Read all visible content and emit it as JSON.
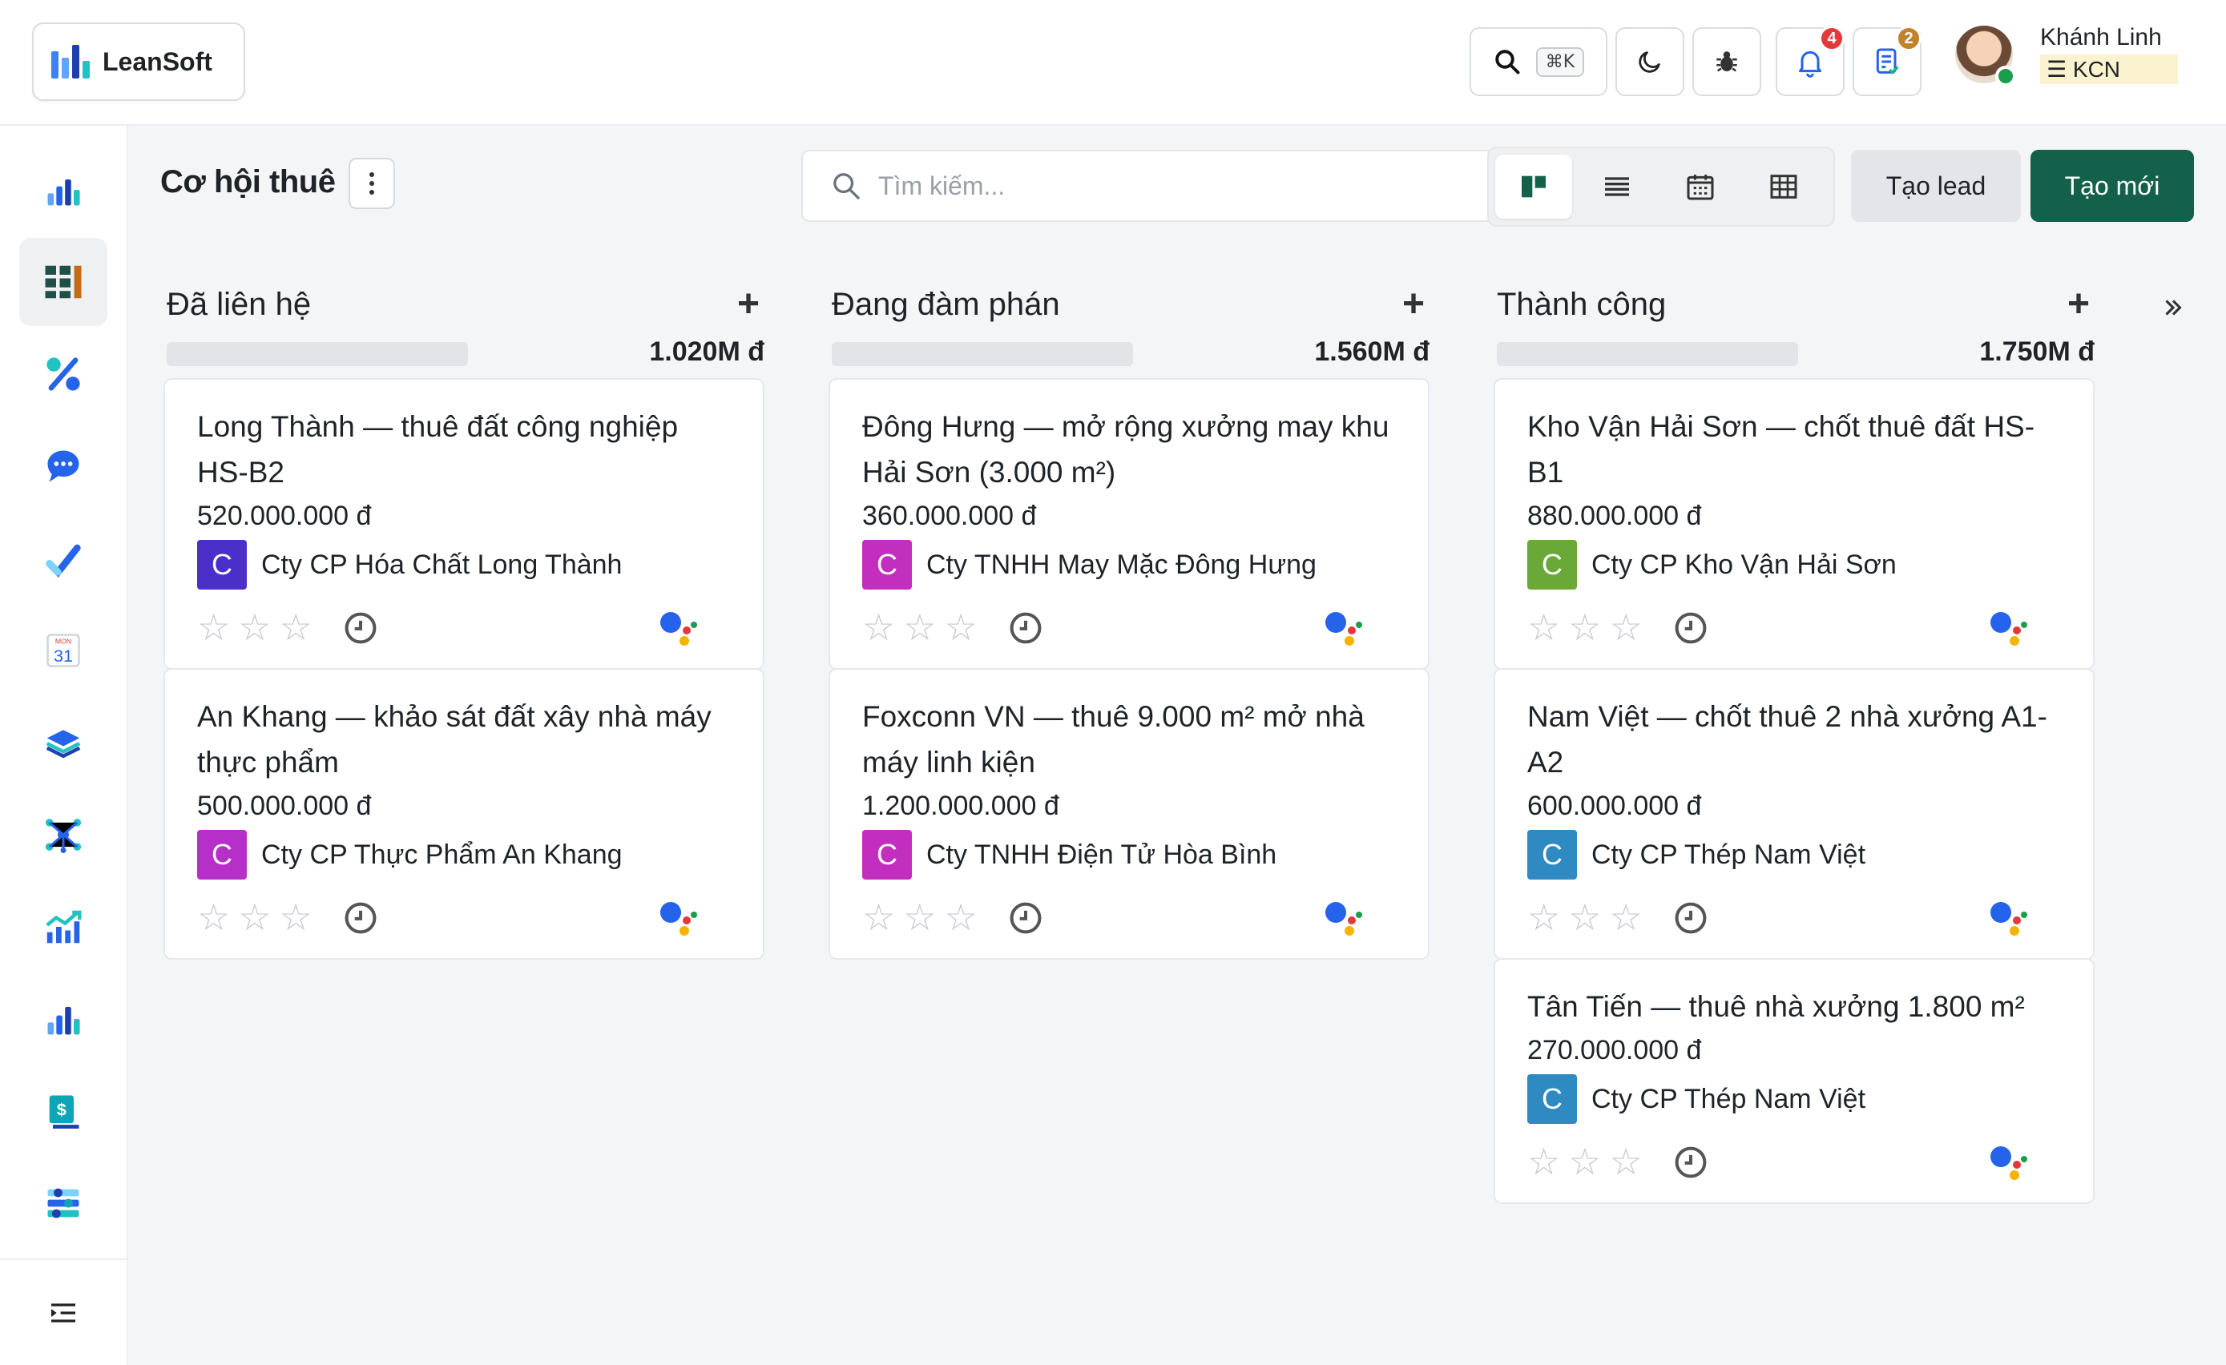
{
  "app": {
    "name": "LeanSoft"
  },
  "topbar": {
    "shortcut_label": "⌘K",
    "notifications_count": "4",
    "tasks_count": "2",
    "badge_notifications_color": "#e5383b",
    "badge_tasks_color": "#c0822b"
  },
  "user": {
    "name": "Khánh Linh",
    "org": "KCN"
  },
  "page": {
    "title": "Cơ hội thuê"
  },
  "search": {
    "placeholder": "Tìm kiếm..."
  },
  "actions": {
    "lead_label": "Tạo lead",
    "new_label": "Tạo mới"
  },
  "columns": [
    {
      "name": "Đã liên hệ",
      "total": "1.020M đ",
      "cards": [
        {
          "title": "Long Thành — thuê đất công nghiệp HS-B2",
          "amount": "520.000.000 đ",
          "avatar": "C",
          "avatar_color": "#4b2fc9",
          "company": "Cty CP Hóa Chất Long Thành"
        },
        {
          "title": "An Khang — khảo sát đất xây nhà máy thực phẩm",
          "amount": "500.000.000 đ",
          "avatar": "C",
          "avatar_color": "#b62fc9",
          "company": "Cty CP Thực Phẩm An Khang"
        }
      ]
    },
    {
      "name": "Đang đàm phán",
      "total": "1.560M đ",
      "cards": [
        {
          "title": "Đông Hưng — mở rộng xưởng may khu Hải Sơn (3.000 m²)",
          "amount": "360.000.000 đ",
          "avatar": "C",
          "avatar_color": "#c22fbf",
          "company": "Cty TNHH May Mặc Đông Hưng"
        },
        {
          "title": "Foxconn VN — thuê 9.000 m² mở nhà máy linh kiện",
          "amount": "1.200.000.000 đ",
          "avatar": "C",
          "avatar_color": "#c22fbf",
          "company": "Cty TNHH Điện Tử Hòa Bình"
        }
      ]
    },
    {
      "name": "Thành công",
      "total": "1.750M đ",
      "cards": [
        {
          "title": "Kho Vận Hải Sơn — chốt thuê đất HS-B1",
          "amount": "880.000.000 đ",
          "avatar": "C",
          "avatar_color": "#6aa938",
          "company": "Cty CP Kho Vận Hải Sơn"
        },
        {
          "title": "Nam Việt — chốt thuê 2 nhà xưởng A1-A2",
          "amount": "600.000.000 đ",
          "avatar": "C",
          "avatar_color": "#2f8ac2",
          "company": "Cty CP Thép Nam Việt"
        },
        {
          "title": "Tân Tiến — thuê nhà xưởng 1.800 m²",
          "amount": "270.000.000 đ",
          "avatar": "C",
          "avatar_color": "#2f8ac2",
          "company": "Cty CP Thép Nam Việt"
        }
      ]
    }
  ],
  "sidebar": {
    "items": [
      "dashboard-icon",
      "kanban-icon",
      "percent-icon",
      "chat-icon",
      "tasks-icon",
      "calendar-icon",
      "stack-icon",
      "network-icon",
      "trend-icon",
      "bar-chart-icon",
      "invoice-icon",
      "settings-flow-icon"
    ],
    "calendar_month": "MON",
    "calendar_day": "31"
  },
  "accent_color": "#13614a"
}
